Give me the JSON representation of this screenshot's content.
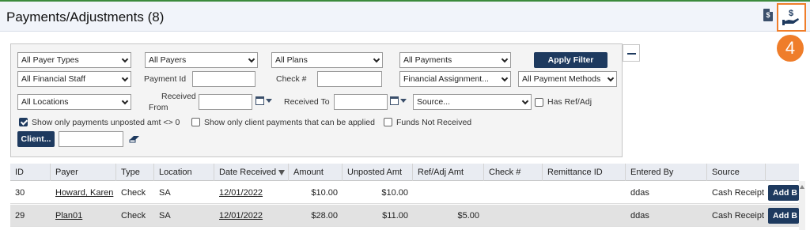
{
  "header": {
    "title": "Payments/Adjustments (8)",
    "doc_icon_glyph": "$",
    "step_badge": "4"
  },
  "filters": {
    "payer_types": "All Payer Types",
    "payers": "All Payers",
    "plans": "All Plans",
    "payments": "All Payments",
    "apply_label": "Apply Filter",
    "financial_staff": "All Financial Staff",
    "payment_id_label": "Payment Id",
    "payment_id_value": "",
    "check_label": "Check #",
    "check_value": "",
    "financial_assignment": "Financial Assignment...",
    "payment_methods": "All Payment Methods",
    "locations": "All Locations",
    "received_from_label_1": "Received",
    "received_from_label_2": "From",
    "received_from_value": "",
    "received_to_label": "Received To",
    "received_to_value": "",
    "source": "Source...",
    "has_ref_adj_label": "Has Ref/Adj",
    "has_ref_adj_checked": false,
    "unposted_label": "Show only payments unposted amt <> 0",
    "unposted_checked": true,
    "client_payments_label": "Show only client payments that can be applied",
    "client_payments_checked": false,
    "funds_not_received_label": "Funds Not Received",
    "funds_not_received_checked": false,
    "client_button": "Client...",
    "client_value": ""
  },
  "table": {
    "columns": [
      "ID",
      "Payer",
      "Type",
      "Location",
      "Date Received",
      "Amount",
      "Unposted Amt",
      "Ref/Adj Amt",
      "Check #",
      "Remittance ID",
      "Entered By",
      "Source"
    ],
    "rows": [
      {
        "id": "30",
        "payer": "Howard, Karen",
        "type": "Check",
        "location": "SA",
        "date_received": "12/01/2022",
        "amount": "$10.00",
        "unposted": "$10.00",
        "ref_adj": "",
        "check": "",
        "remittance": "",
        "entered_by": "ddas",
        "source": "Cash Receipt",
        "action": "Add B"
      },
      {
        "id": "29",
        "payer": "Plan01",
        "type": "Check",
        "location": "SA",
        "date_received": "12/01/2022",
        "amount": "$28.00",
        "unposted": "$11.00",
        "ref_adj": "$5.00",
        "check": "",
        "remittance": "",
        "entered_by": "ddas",
        "source": "Cash Receipt",
        "action": "Add B"
      }
    ]
  },
  "colors": {
    "accent": "#1e3a5f",
    "highlight": "#ef7d2a",
    "header_bg": "#f1f4fa"
  }
}
